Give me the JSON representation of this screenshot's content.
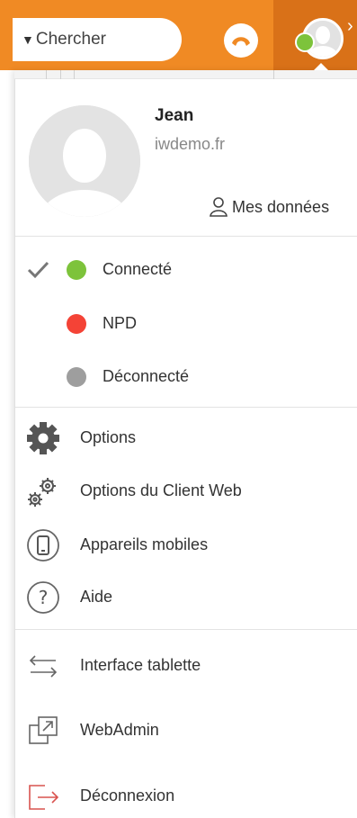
{
  "header": {
    "search_placeholder": "Chercher",
    "accent_color": "#f08a24"
  },
  "user": {
    "name": "Jean",
    "domain": "iwdemo.fr",
    "my_data_label": "Mes données",
    "presence_color": "#7dc33b"
  },
  "presence": [
    {
      "label": "Connecté",
      "color": "#7dc33b",
      "selected": true
    },
    {
      "label": "NPD",
      "color": "#f44336",
      "selected": false
    },
    {
      "label": "Déconnecté",
      "color": "#9e9e9e",
      "selected": false
    }
  ],
  "menu_settings": [
    {
      "label": "Options",
      "icon": "gear-icon"
    },
    {
      "label": "Options du Client Web",
      "icon": "gears-icon"
    },
    {
      "label": "Appareils mobiles",
      "icon": "mobile-icon"
    },
    {
      "label": "Aide",
      "icon": "help-icon"
    }
  ],
  "menu_actions": [
    {
      "label": "Interface tablette",
      "icon": "swap-arrows-icon"
    },
    {
      "label": "WebAdmin",
      "icon": "external-link-icon"
    },
    {
      "label": "Déconnexion",
      "icon": "logout-icon",
      "color": "#d9534f"
    }
  ]
}
